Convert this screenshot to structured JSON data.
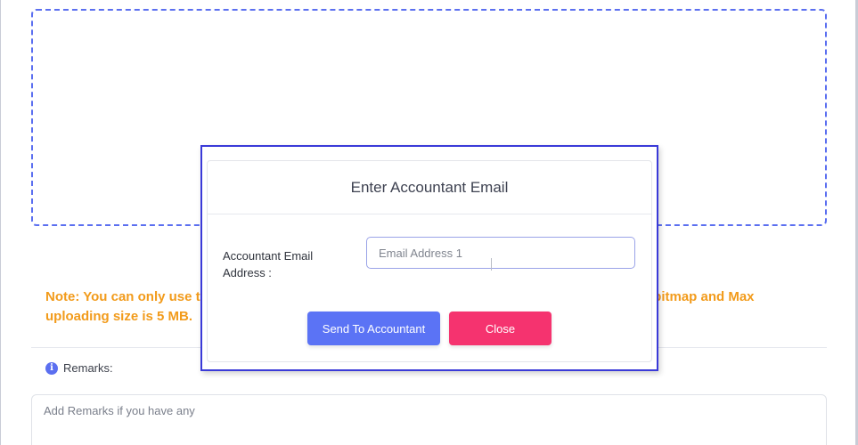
{
  "note": {
    "left_text": "Note: You can only use t",
    "right_text": ",bitmap and Max",
    "line2": "uploading size is 5 MB."
  },
  "remarks": {
    "label": "Remarks:",
    "icon": "info-icon",
    "placeholder": "Add Remarks if you have any"
  },
  "modal": {
    "title": "Enter Accountant Email",
    "field_label": "Accountant Email Address :",
    "email_placeholder": "Email Address 1",
    "send_label": "Send To Accountant",
    "close_label": "Close"
  },
  "colors": {
    "accent": "#5b73f5",
    "danger": "#f5336f",
    "note": "#f29b1b",
    "dropzone_border": "#5b6ff0",
    "modal_border": "#3a3ad8"
  }
}
